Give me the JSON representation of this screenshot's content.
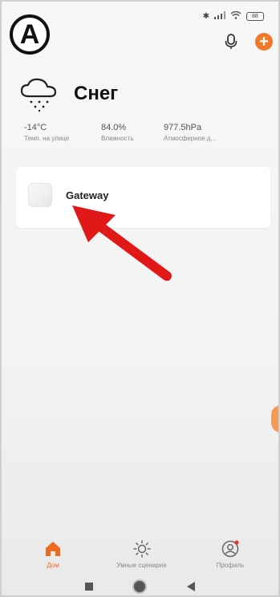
{
  "badge": {
    "label": "A"
  },
  "status": {
    "battery": "88"
  },
  "weather": {
    "title": "Снег",
    "metrics": [
      {
        "value": "-14°C",
        "label": "Темп. на улице"
      },
      {
        "value": "84.0%",
        "label": "Влажность"
      },
      {
        "value": "977.5hPa",
        "label": "Атмосферное д..."
      }
    ]
  },
  "device": {
    "name": "Gateway"
  },
  "nav": {
    "items": [
      {
        "label": "Дом",
        "icon": "home-icon",
        "active": true
      },
      {
        "label": "Умные сценарии",
        "icon": "sun-icon",
        "active": false
      },
      {
        "label": "Профиль",
        "icon": "profile-icon",
        "active": false
      }
    ]
  },
  "colors": {
    "accent": "#ef6b1f",
    "arrow": "#e01818"
  }
}
